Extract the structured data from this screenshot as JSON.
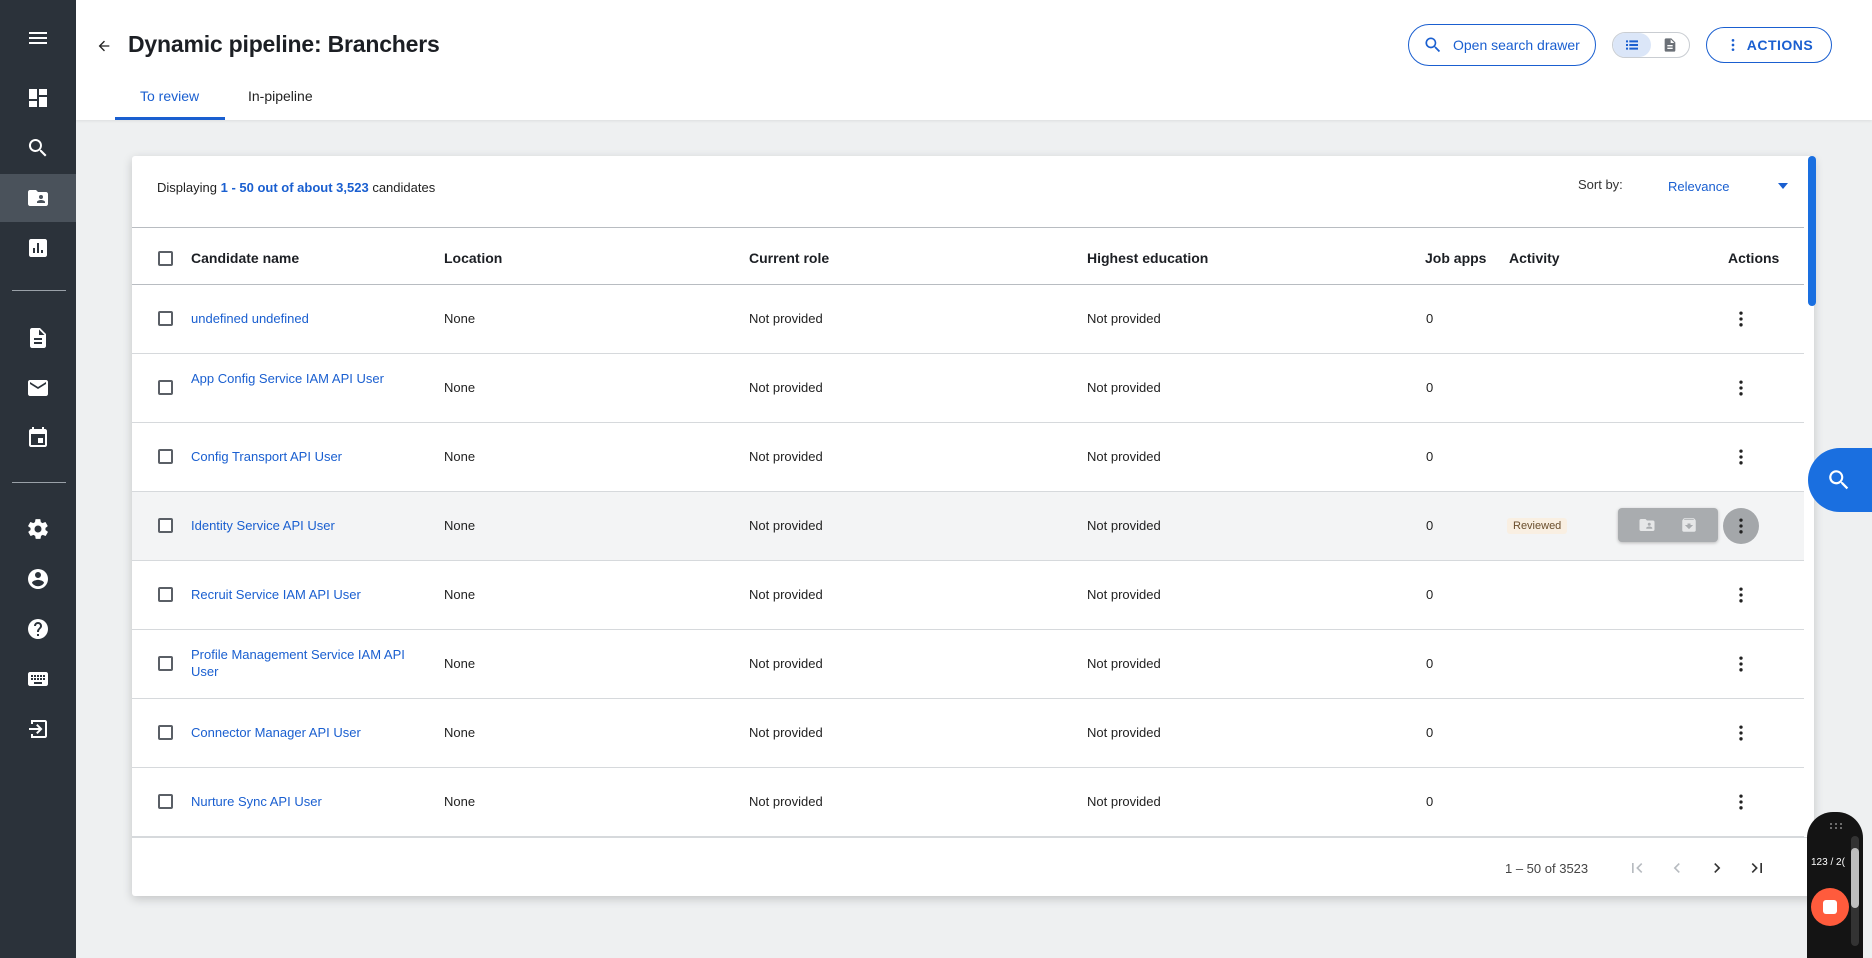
{
  "page": {
    "title": "Dynamic pipeline: Branchers",
    "tabs": [
      {
        "label": "To review",
        "active": true
      },
      {
        "label": "In-pipeline",
        "active": false
      }
    ]
  },
  "toolbar": {
    "search_drawer_label": "Open search drawer",
    "actions_label": "ACTIONS"
  },
  "sidebar": {
    "items": [
      "menu-icon",
      "dashboard-icon",
      "search-icon",
      "contacts-icon",
      "reports-icon",
      "document-icon",
      "mail-icon",
      "calendar-icon",
      "settings-icon",
      "account-icon",
      "help-icon",
      "keyboard-icon",
      "logout-icon"
    ],
    "active": "contacts-icon"
  },
  "summary": {
    "prefix": "Displaying",
    "range": "1 - 50 out of about 3,523",
    "suffix": "candidates"
  },
  "sort": {
    "label": "Sort by:",
    "value": "Relevance"
  },
  "table": {
    "columns": [
      "Candidate name",
      "Location",
      "Current role",
      "Highest education",
      "Job apps",
      "Activity",
      "Actions"
    ],
    "rows": [
      {
        "name": "undefined undefined",
        "location": "None",
        "role": "Not provided",
        "education": "Not provided",
        "job_apps": "0",
        "activity": ""
      },
      {
        "name": "App Config Service IAM API User",
        "location": "None",
        "role": "Not provided",
        "education": "Not provided",
        "job_apps": "0",
        "activity": ""
      },
      {
        "name": "Config Transport API User",
        "location": "None",
        "role": "Not provided",
        "education": "Not provided",
        "job_apps": "0",
        "activity": ""
      },
      {
        "name": "Identity Service API User",
        "location": "None",
        "role": "Not provided",
        "education": "Not provided",
        "job_apps": "0",
        "activity": "Reviewed"
      },
      {
        "name": "Recruit Service IAM API User",
        "location": "None",
        "role": "Not provided",
        "education": "Not provided",
        "job_apps": "0",
        "activity": ""
      },
      {
        "name": "Profile Management Service IAM API User",
        "location": "None",
        "role": "Not provided",
        "education": "Not provided",
        "job_apps": "0",
        "activity": ""
      },
      {
        "name": "Connector Manager API User",
        "location": "None",
        "role": "Not provided",
        "education": "Not provided",
        "job_apps": "0",
        "activity": ""
      },
      {
        "name": "Nurture Sync API User",
        "location": "None",
        "role": "Not provided",
        "education": "Not provided",
        "job_apps": "0",
        "activity": ""
      }
    ]
  },
  "pagination": {
    "label": "1 – 50 of 3523"
  },
  "recorder": {
    "count": "123 / 2("
  },
  "colors": {
    "accent": "#1a5fd0",
    "sidebar_bg": "#2b323a",
    "reviewed_badge_bg": "#f9efe2"
  }
}
